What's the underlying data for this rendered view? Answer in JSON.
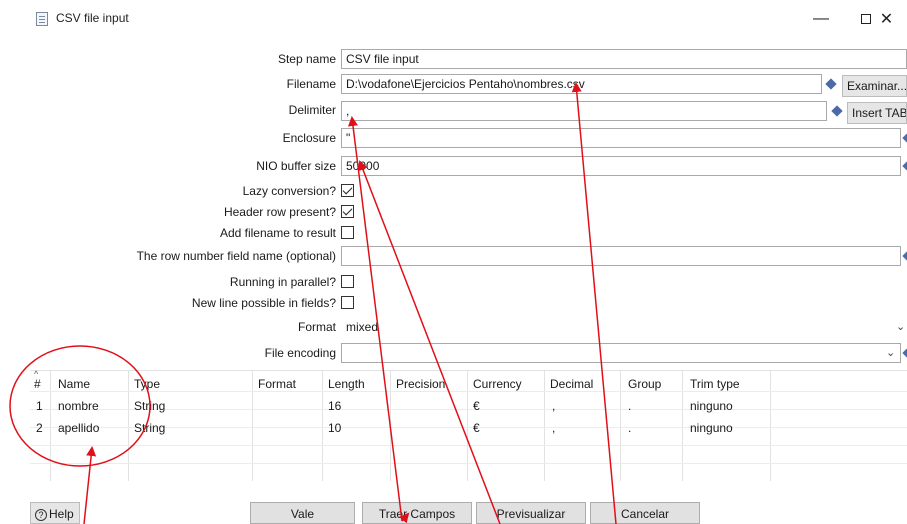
{
  "window": {
    "title": "CSV file input",
    "minimize": "—",
    "close": "✕"
  },
  "form": {
    "step_name": {
      "label": "Step name",
      "value": "CSV file input"
    },
    "filename": {
      "label": "Filename",
      "value": "D:\\vodafone\\Ejercicios Pentaho\\nombres.csv",
      "button": "Examinar..."
    },
    "delimiter": {
      "label": "Delimiter",
      "value": ",",
      "button": "Insert TAB"
    },
    "enclosure": {
      "label": "Enclosure",
      "value": "\""
    },
    "nio_buffer": {
      "label": "NIO buffer size",
      "value": "50000"
    },
    "lazy_conversion": {
      "label": "Lazy conversion?",
      "checked": true
    },
    "header_row": {
      "label": "Header row present?",
      "checked": true
    },
    "add_filename": {
      "label": "Add filename to result",
      "checked": false
    },
    "row_number_field": {
      "label": "The row number field name (optional)",
      "value": ""
    },
    "running_parallel": {
      "label": "Running in parallel?",
      "checked": false
    },
    "new_line": {
      "label": "New line possible in fields?",
      "checked": false
    },
    "format": {
      "label": "Format",
      "value": "mixed"
    },
    "file_encoding": {
      "label": "File encoding",
      "value": ""
    }
  },
  "table": {
    "columns": [
      "#",
      "Name",
      "Type",
      "Format",
      "Length",
      "Precision",
      "Currency",
      "Decimal",
      "Group",
      "Trim type"
    ],
    "rows": [
      [
        "1",
        "nombre",
        "String",
        "",
        "16",
        "",
        "€",
        ",",
        ".",
        "ninguno"
      ],
      [
        "2",
        "apellido",
        "String",
        "",
        "10",
        "",
        "€",
        ",",
        ".",
        "ninguno"
      ]
    ]
  },
  "buttons": {
    "help": "Help",
    "ok": "Vale",
    "get_fields": "Traer Campos",
    "preview": "Previsualizar",
    "cancel": "Cancelar"
  },
  "colors": {
    "annotation": "#e0101a",
    "diamond_icon": "#4b6aa8"
  }
}
